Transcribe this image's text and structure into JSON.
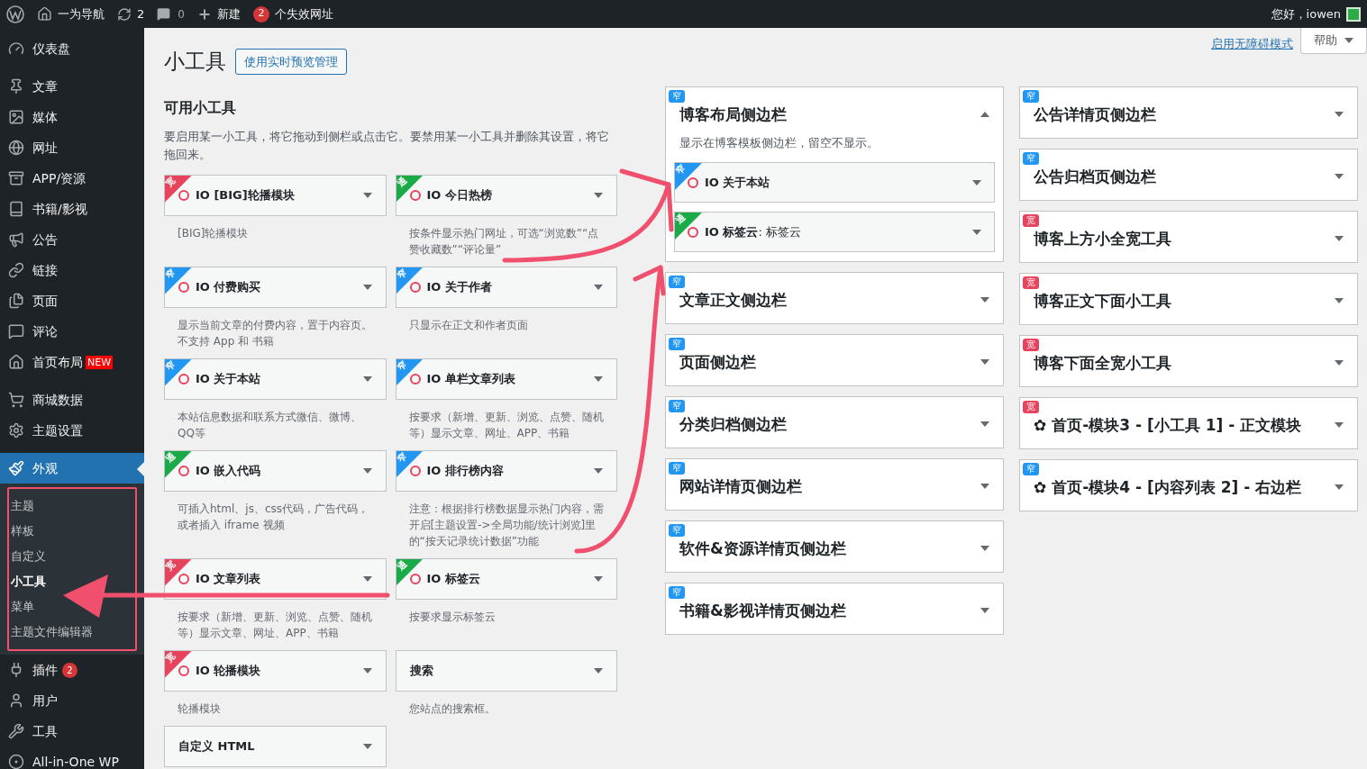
{
  "admin_bar": {
    "site": "一为导航",
    "updates": "2",
    "comments": "0",
    "new": "新建",
    "alert_count": "2",
    "alert_text": "个失效网址",
    "greeting": "您好，iowen"
  },
  "menu": {
    "groups": [
      [
        {
          "label": "仪表盘",
          "selected": false
        }
      ],
      [
        {
          "label": "文章",
          "selected": false
        },
        {
          "label": "媒体",
          "selected": false
        },
        {
          "label": "网址",
          "selected": false
        },
        {
          "label": "APP/资源",
          "selected": false
        },
        {
          "label": "书籍/影视",
          "selected": false
        },
        {
          "label": "公告",
          "selected": false
        },
        {
          "label": "链接",
          "selected": false
        },
        {
          "label": "页面",
          "selected": false
        },
        {
          "label": "评论",
          "selected": false
        },
        {
          "label": "首页布局",
          "badge": "NEW",
          "selected": false
        }
      ],
      [
        {
          "label": "商城数据",
          "selected": false
        },
        {
          "label": "主题设置",
          "selected": false
        }
      ],
      [
        {
          "label": "外观",
          "selected": true,
          "children": [
            {
              "label": "主题",
              "selected": false
            },
            {
              "label": "样板",
              "selected": false
            },
            {
              "label": "自定义",
              "selected": false
            },
            {
              "label": "小工具",
              "selected": true
            },
            {
              "label": "菜单",
              "selected": false
            },
            {
              "label": "主题文件编辑器",
              "selected": false
            }
          ]
        },
        {
          "label": "插件",
          "count": "2",
          "selected": false
        },
        {
          "label": "用户",
          "selected": false
        },
        {
          "label": "工具",
          "selected": false
        },
        {
          "label": "All-in-One WP",
          "selected": false
        }
      ]
    ]
  },
  "page": {
    "title": "小工具",
    "preview_button": "使用实时预览管理",
    "a11y_link": "启用无障碍模式",
    "help": "帮助"
  },
  "available": {
    "heading": "可用小工具",
    "description": "要启用某一小工具，将它拖动到侧栏或点击它。要禁用某一小工具并删除其设置，将它拖回来。",
    "widgets": [
      {
        "title": "IO [BIG]轮播模块",
        "io": true,
        "tag": {
          "text": "宽",
          "kind": "wide"
        },
        "description": "[BIG]轮播模块"
      },
      {
        "title": "IO 今日热榜",
        "io": true,
        "tag": {
          "text": "通",
          "kind": "any"
        },
        "description": "按条件显示热门网址，可选“浏览数”“点赞收藏数”“评论量”"
      },
      {
        "title": "IO 付费购买",
        "io": true,
        "tag": {
          "text": "窄",
          "kind": "narrow"
        },
        "description": "显示当前文章的付费内容，置于内容页。不支持 App 和 书籍"
      },
      {
        "title": "IO 关于作者",
        "io": true,
        "tag": {
          "text": "窄",
          "kind": "narrow"
        },
        "description": "只显示在正文和作者页面"
      },
      {
        "title": "IO 关于本站",
        "io": true,
        "tag": {
          "text": "窄",
          "kind": "narrow"
        },
        "description": "本站信息数据和联系方式微信、微博、QQ等"
      },
      {
        "title": "IO 单栏文章列表",
        "io": true,
        "tag": {
          "text": "窄",
          "kind": "narrow"
        },
        "description": "按要求（新增、更新、浏览、点赞、随机等）显示文章、网址、APP、书籍"
      },
      {
        "title": "IO 嵌入代码",
        "io": true,
        "tag": {
          "text": "通",
          "kind": "any"
        },
        "description": "可插入html、js、css代码，广告代码，或者插入 iframe 视频"
      },
      {
        "title": "IO 排行榜内容",
        "io": true,
        "tag": {
          "text": "窄",
          "kind": "narrow"
        },
        "description": "注意：根据排行榜数据显示热门内容，需开启[主题设置->全局功能/统计浏览]里的“按天记录统计数据”功能"
      },
      {
        "title": "IO 文章列表",
        "io": true,
        "tag": {
          "text": "宽",
          "kind": "wide"
        },
        "description": "按要求（新增、更新、浏览、点赞、随机等）显示文章、网址、APP、书籍"
      },
      {
        "title": "IO 标签云",
        "io": true,
        "tag": {
          "text": "通",
          "kind": "any"
        },
        "description": "按要求显示标签云"
      },
      {
        "title": "IO 轮播模块",
        "io": true,
        "tag": {
          "text": "宽",
          "kind": "wide"
        },
        "description": "轮播模块"
      },
      {
        "title": "搜索",
        "io": false,
        "description": "您站点的搜索框。"
      },
      {
        "title": "自定义 HTML",
        "io": false
      }
    ]
  },
  "sidebars": {
    "columns": [
      [
        {
          "title": "博客布局侧边栏",
          "tag": {
            "text": "窄",
            "kind": "narrow"
          },
          "expanded": true,
          "description": "显示在博客模板侧边栏，留空不显示。",
          "widgets": [
            {
              "title": "IO 关于本站",
              "io": true,
              "tag": {
                "text": "窄",
                "kind": "narrow"
              }
            },
            {
              "title": "IO 标签云",
              "suffix": ": 标签云",
              "io": true,
              "tag": {
                "text": "通",
                "kind": "any"
              }
            }
          ]
        },
        {
          "title": "文章正文侧边栏",
          "tag": {
            "text": "窄",
            "kind": "narrow"
          },
          "expanded": false
        },
        {
          "title": "页面侧边栏",
          "tag": {
            "text": "窄",
            "kind": "narrow"
          },
          "expanded": false
        },
        {
          "title": "分类归档侧边栏",
          "tag": {
            "text": "窄",
            "kind": "narrow"
          },
          "expanded": false
        },
        {
          "title": "网站详情页侧边栏",
          "tag": {
            "text": "窄",
            "kind": "narrow"
          },
          "expanded": false
        },
        {
          "title": "软件&资源详情页侧边栏",
          "tag": {
            "text": "窄",
            "kind": "narrow"
          },
          "expanded": false
        },
        {
          "title": "书籍&影视详情页侧边栏",
          "tag": {
            "text": "窄",
            "kind": "narrow"
          },
          "expanded": false
        }
      ],
      [
        {
          "title": "公告详情页侧边栏",
          "tag": {
            "text": "窄",
            "kind": "narrow"
          },
          "expanded": false
        },
        {
          "title": "公告归档页侧边栏",
          "tag": {
            "text": "窄",
            "kind": "narrow"
          },
          "expanded": false
        },
        {
          "title": "博客上方小全宽工具",
          "tag": {
            "text": "宽",
            "kind": "wide"
          },
          "expanded": false
        },
        {
          "title": "博客正文下面小工具",
          "tag": {
            "text": "宽",
            "kind": "wide"
          },
          "expanded": false
        },
        {
          "title": "博客下面全宽小工具",
          "tag": {
            "text": "宽",
            "kind": "wide"
          },
          "expanded": false
        },
        {
          "title": "✿ 首页-模块3 - [小工具 1] - 正文模块",
          "tag": {
            "text": "宽",
            "kind": "wide"
          },
          "expanded": false
        },
        {
          "title": "✿ 首页-模块4 - [内容列表 2] - 右边栏",
          "tag": {
            "text": "窄",
            "kind": "narrow"
          },
          "expanded": false
        }
      ]
    ]
  }
}
